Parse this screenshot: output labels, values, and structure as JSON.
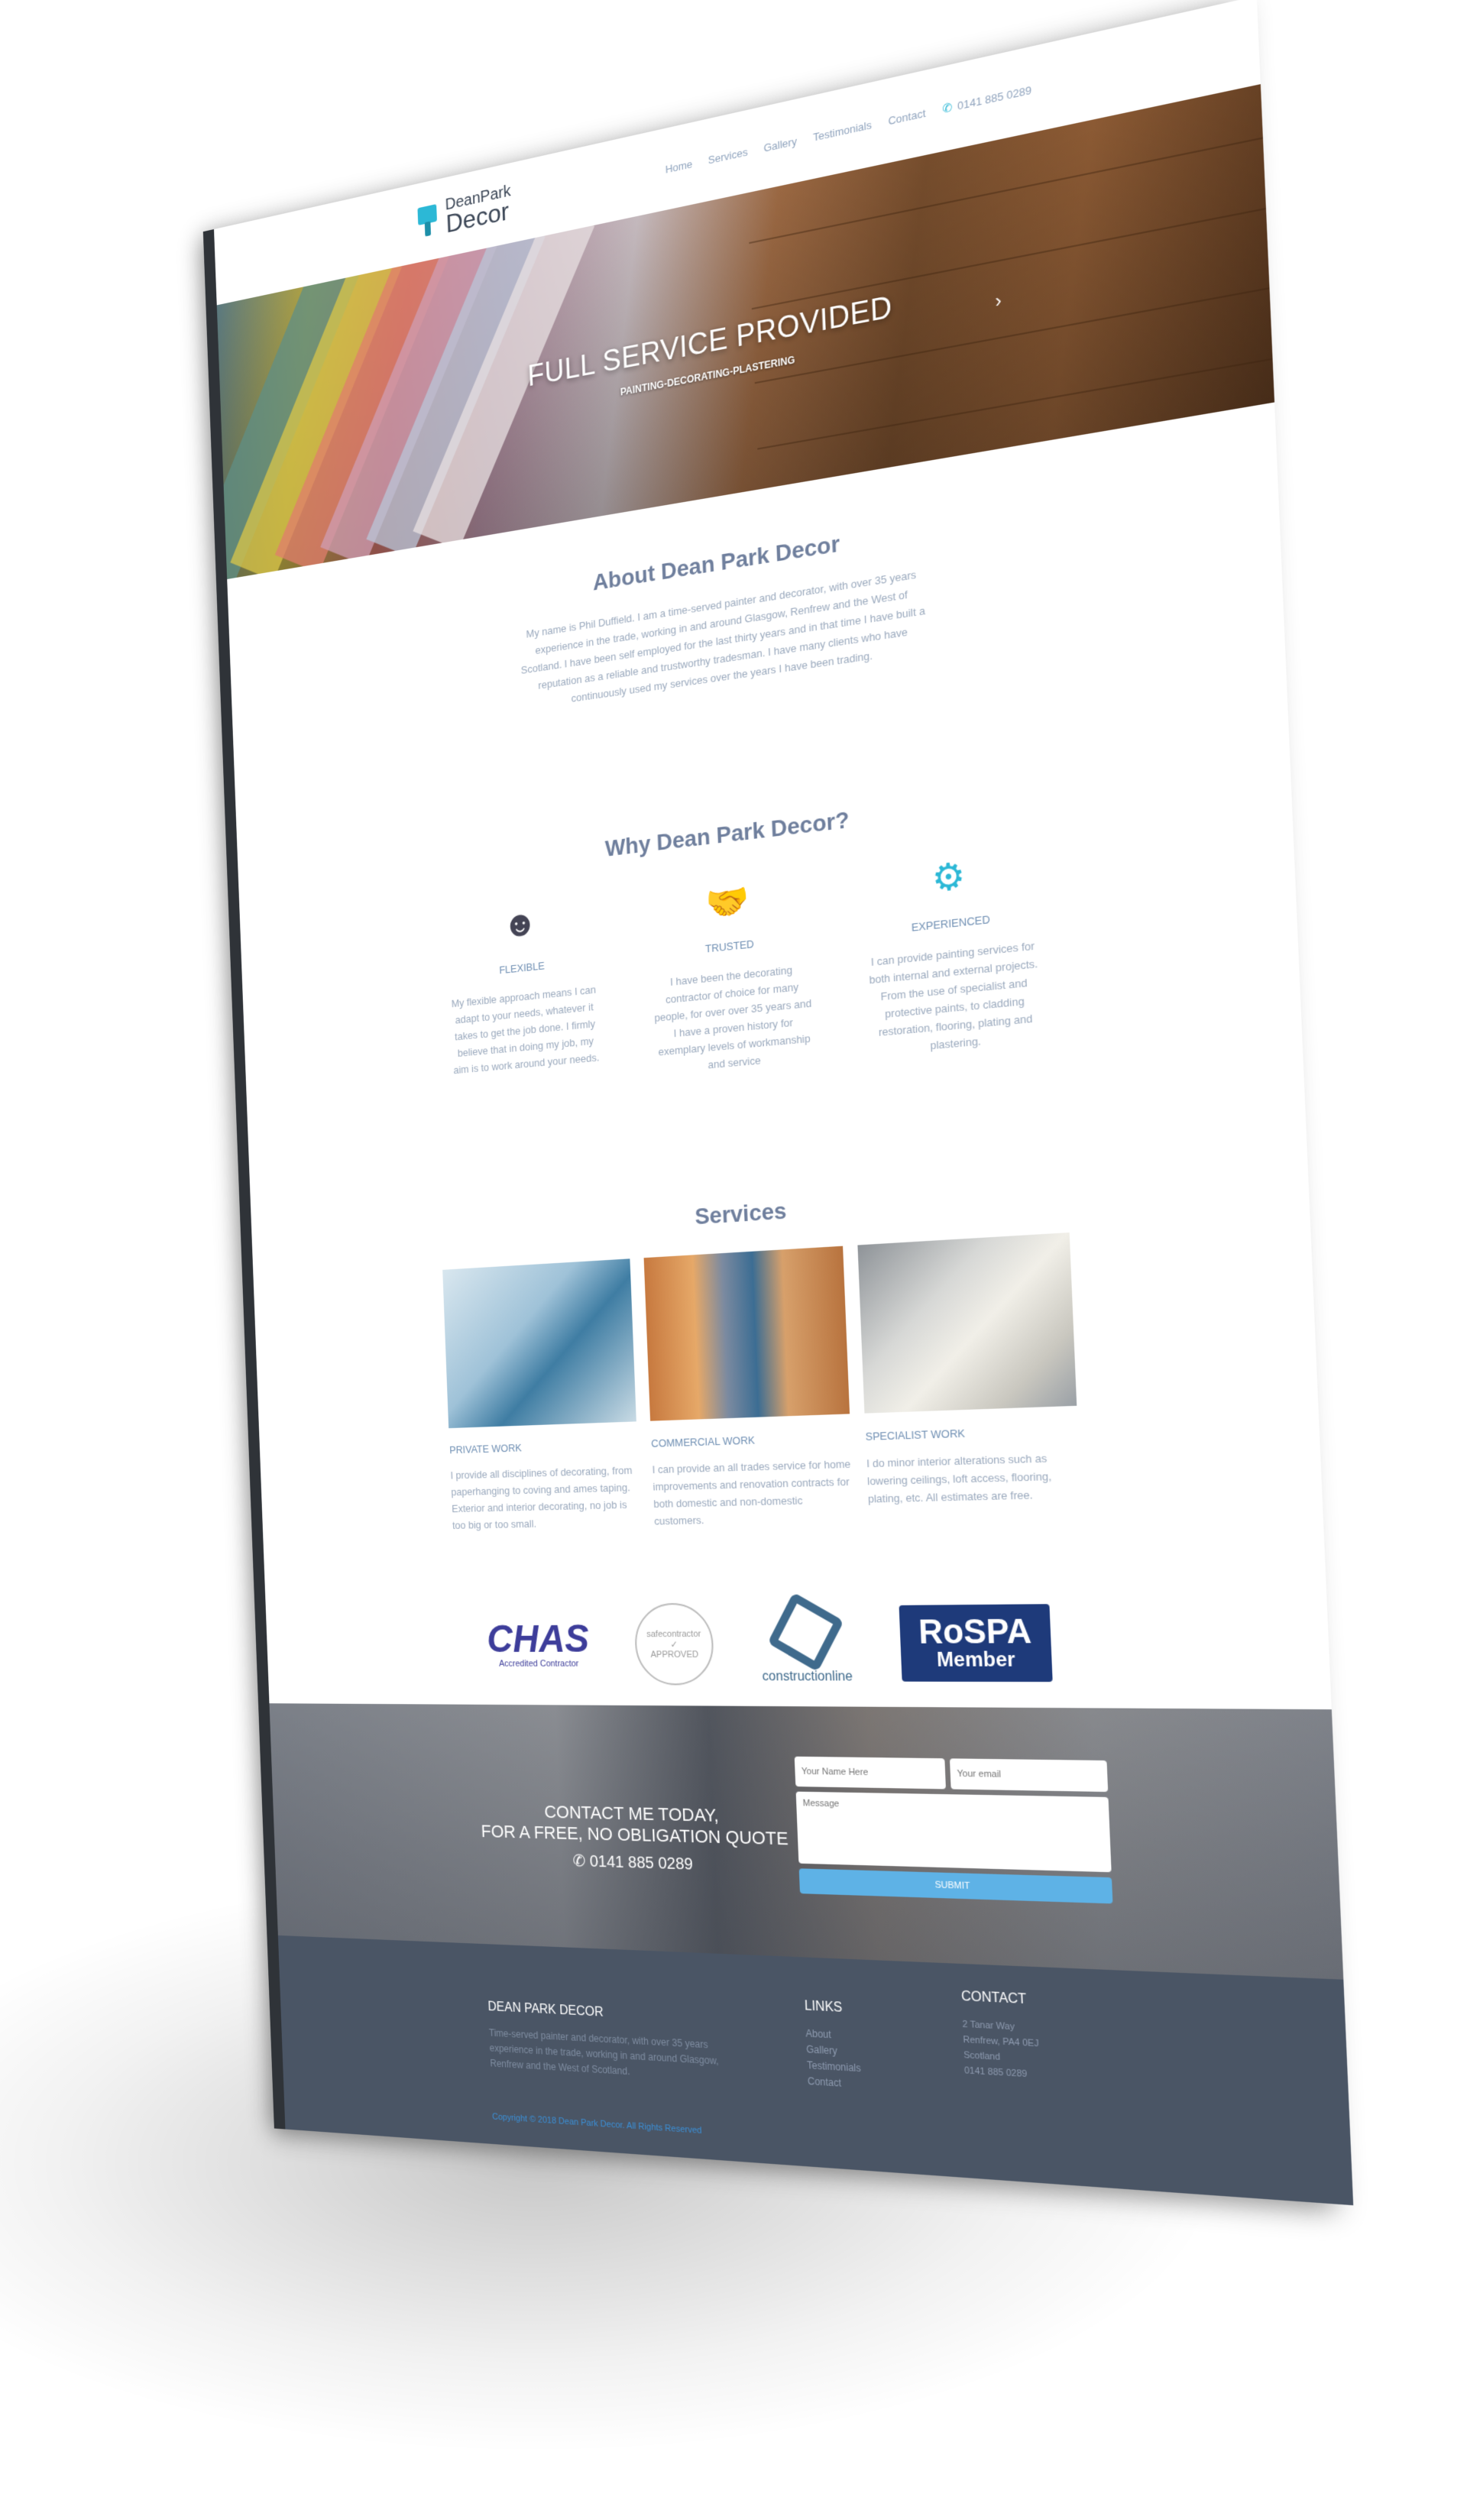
{
  "brand": {
    "name_line1": "DeanPark",
    "name_line2": "Decor",
    "color": "#2cb8d6"
  },
  "nav": {
    "items": [
      "Home",
      "Services",
      "Gallery",
      "Testimonials",
      "Contact"
    ],
    "phone": "0141 885 0289"
  },
  "hero": {
    "title": "FULL SERVICE PROVIDED",
    "subtitle": "PAINTING-DECORATING-PLASTERING"
  },
  "about": {
    "title": "About Dean Park Decor",
    "text": "My name is Phil Duffield. I am a time-served painter and decorator, with over 35 years experience in the trade, working in and around Glasgow, Renfrew and the West of Scotland. I have been self employed for the last thirty years and in that time I have built a reputation as a reliable and trustworthy tradesman. I have many clients who have continuously used my services over the years I have been trading."
  },
  "why": {
    "title": "Why Dean Park Decor?",
    "items": [
      {
        "icon": "person-check-icon",
        "heading": "FLEXIBLE",
        "text": "My flexible approach means I can adapt to your needs, whatever it takes to get the job done. I firmly believe that in doing my job, my aim is to work around your needs."
      },
      {
        "icon": "handshake-icon",
        "heading": "TRUSTED",
        "text": "I have been the decorating contractor of choice for many people, for over over 35 years and I have a proven history for exemplary levels of workmanship and service"
      },
      {
        "icon": "head-gear-icon",
        "heading": "EXPERIENCED",
        "text": "I can provide painting services for both internal and external projects. From the use of specialist and protective paints, to cladding restoration, flooring, plating and plastering."
      }
    ]
  },
  "services": {
    "title": "Services",
    "items": [
      {
        "heading": "PRIVATE WORK",
        "text": "I provide all disciplines of decorating, from paperhanging to coving and ames taping. Exterior and interior decorating, no job is too big or too small."
      },
      {
        "heading": "COMMERCIAL WORK",
        "text": "I can provide an all trades service for home improvements and renovation contracts for both domestic and non-domestic customers."
      },
      {
        "heading": "SPECIALIST WORK",
        "text": "I do minor interior alterations such as lowering ceilings, loft access, flooring, plating, etc. All estimates are free."
      }
    ]
  },
  "accreditations": {
    "chas": {
      "logo": "CHAS",
      "caption": "Accredited Contractor"
    },
    "safecontractor": {
      "line1": "safecontractor",
      "line2": "APPROVED"
    },
    "constructionline": {
      "name": "constructionline"
    },
    "rospa": {
      "line1": "RoSPA",
      "line2": "Member"
    }
  },
  "contact": {
    "line1": "CONTACT ME TODAY,",
    "line2": "FOR A FREE, NO OBLIGATION QUOTE",
    "phone": "0141 885 0289",
    "form": {
      "name_placeholder": "Your Name Here",
      "email_placeholder": "Your email",
      "message_placeholder": "Message",
      "submit_label": "SUBMIT"
    }
  },
  "footer": {
    "about_heading": "DEAN PARK DECOR",
    "about_text": "Time-served painter and decorator, with over 35 years experience in the trade, working in and around Glasgow, Renfrew and the West of Scotland.",
    "links_heading": "LINKS",
    "links": [
      "About",
      "Gallery",
      "Testimonials",
      "Contact"
    ],
    "contact_heading": "CONTACT",
    "contact_lines": [
      "2 Tanar Way",
      "Renfrew, PA4 0EJ",
      "Scotland",
      "0141 885 0289"
    ],
    "copyright": "Copyright © 2018 Dean Park Decor. All Rights Reserved"
  }
}
